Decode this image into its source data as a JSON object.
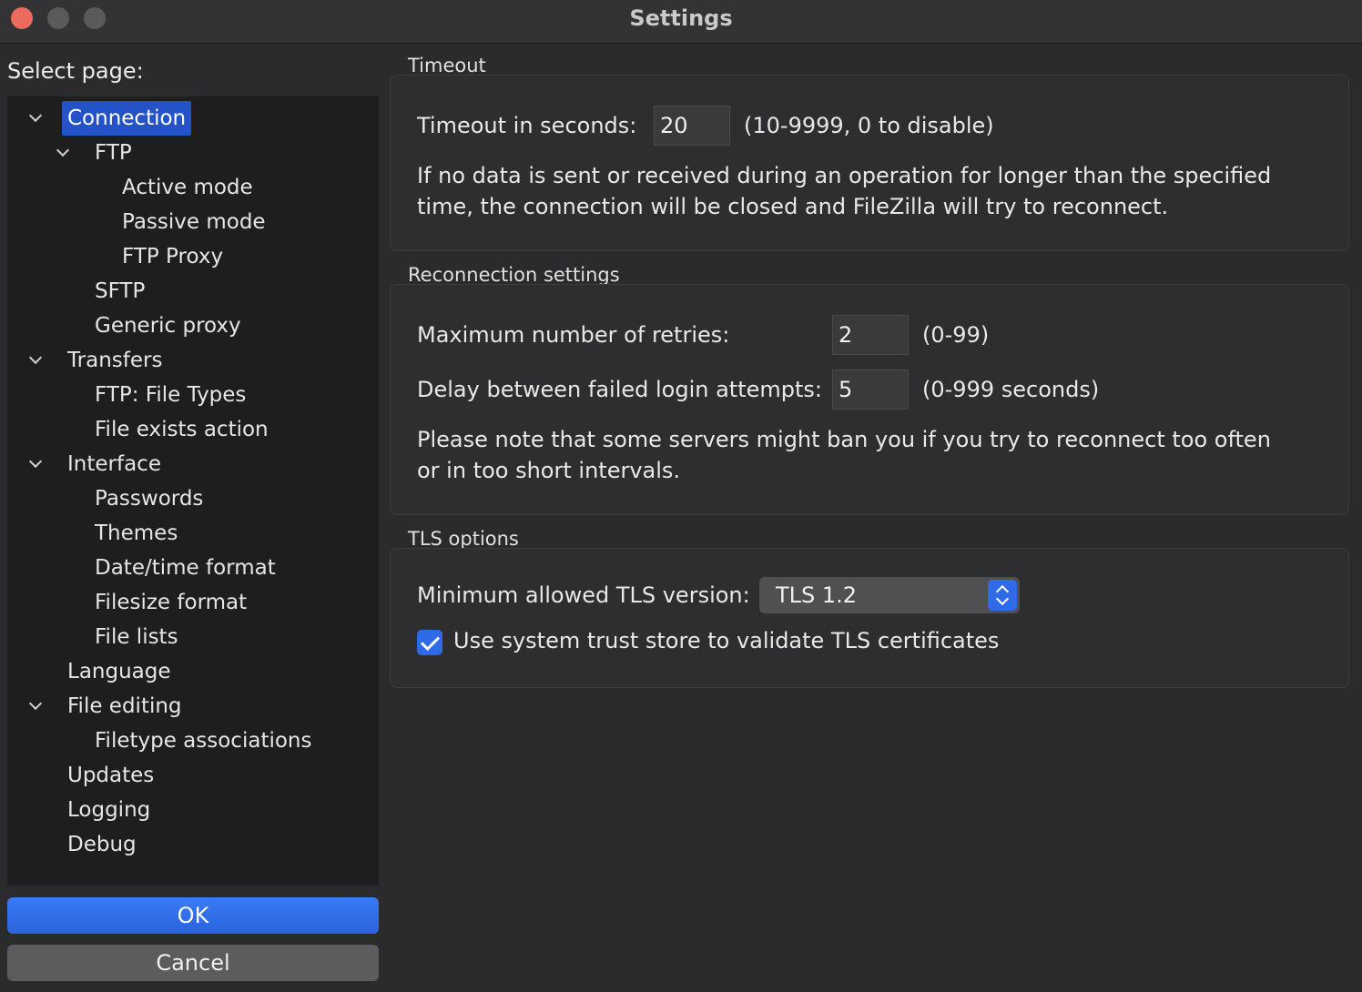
{
  "window": {
    "title": "Settings"
  },
  "sidebar": {
    "label": "Select page:",
    "items": [
      {
        "label": "Connection",
        "level": 0,
        "expanded": true,
        "selected": true
      },
      {
        "label": "FTP",
        "level": 1,
        "expanded": true
      },
      {
        "label": "Active mode",
        "level": 2
      },
      {
        "label": "Passive mode",
        "level": 2
      },
      {
        "label": "FTP Proxy",
        "level": 2
      },
      {
        "label": "SFTP",
        "level": 1
      },
      {
        "label": "Generic proxy",
        "level": 1
      },
      {
        "label": "Transfers",
        "level": 0,
        "expanded": true
      },
      {
        "label": "FTP: File Types",
        "level": 1
      },
      {
        "label": "File exists action",
        "level": 1
      },
      {
        "label": "Interface",
        "level": 0,
        "expanded": true
      },
      {
        "label": "Passwords",
        "level": 1
      },
      {
        "label": "Themes",
        "level": 1
      },
      {
        "label": "Date/time format",
        "level": 1
      },
      {
        "label": "Filesize format",
        "level": 1
      },
      {
        "label": "File lists",
        "level": 1
      },
      {
        "label": "Language",
        "level": 0
      },
      {
        "label": "File editing",
        "level": 0,
        "expanded": true
      },
      {
        "label": "Filetype associations",
        "level": 1
      },
      {
        "label": "Updates",
        "level": 0
      },
      {
        "label": "Logging",
        "level": 0
      },
      {
        "label": "Debug",
        "level": 0
      }
    ]
  },
  "buttons": {
    "ok": "OK",
    "cancel": "Cancel"
  },
  "timeout": {
    "title": "Timeout",
    "label": "Timeout in seconds:",
    "value": "20",
    "range": "(10-9999, 0 to disable)",
    "description": "If no data is sent or received during an operation for longer than the specified time, the connection will be closed and FileZilla will try to reconnect."
  },
  "reconnection": {
    "title": "Reconnection settings",
    "retries_label": "Maximum number of retries:",
    "retries_value": "2",
    "retries_range": "(0-99)",
    "delay_label": "Delay between failed login attempts:",
    "delay_value": "5",
    "delay_range": "(0-999 seconds)",
    "note": "Please note that some servers might ban you if you try to reconnect too often or in too short intervals."
  },
  "tls": {
    "title": "TLS options",
    "min_version_label": "Minimum allowed TLS version:",
    "min_version_value": "TLS 1.2",
    "trust_store_label": "Use system trust store to validate TLS certificates",
    "trust_store_checked": true
  },
  "colors": {
    "accent": "#2f6ae8",
    "selection": "#2452c7",
    "close_button": "#ec6a5e"
  }
}
